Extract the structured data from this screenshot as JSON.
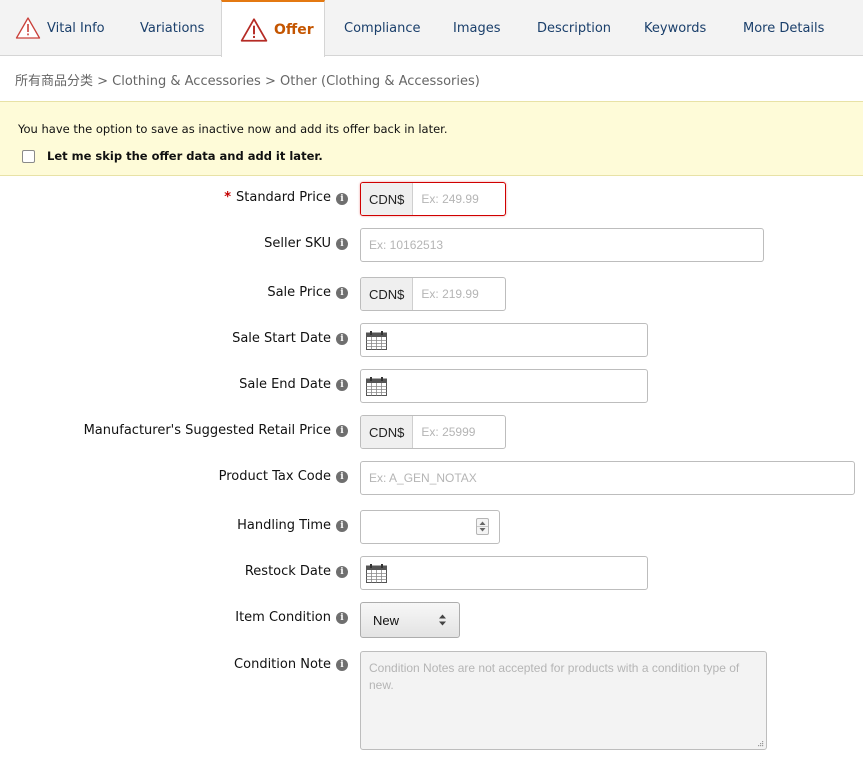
{
  "tabs": [
    {
      "label": "Vital Info",
      "warning": true,
      "active": false
    },
    {
      "label": "Variations",
      "warning": false,
      "active": false
    },
    {
      "label": "Offer",
      "warning": true,
      "active": true
    },
    {
      "label": "Compliance",
      "warning": false,
      "active": false
    },
    {
      "label": "Images",
      "warning": false,
      "active": false
    },
    {
      "label": "Description",
      "warning": false,
      "active": false
    },
    {
      "label": "Keywords",
      "warning": false,
      "active": false
    },
    {
      "label": "More Details",
      "warning": false,
      "active": false
    }
  ],
  "breadcrumb": "所有商品分类 > Clothing & Accessories > Other (Clothing & Accessories)",
  "notice": {
    "text": "You have the option to save as inactive now and add its offer back in later.",
    "skip_label": "Let me skip the offer data and add it later.",
    "skip_checked": false
  },
  "form": {
    "standard_price": {
      "label": "Standard Price",
      "required": "*",
      "currency": "CDN$",
      "placeholder": "Ex: 249.99"
    },
    "seller_sku": {
      "label": "Seller SKU",
      "placeholder": "Ex: 10162513"
    },
    "sale_price": {
      "label": "Sale Price",
      "currency": "CDN$",
      "placeholder": "Ex: 219.99"
    },
    "sale_start_date": {
      "label": "Sale Start Date"
    },
    "sale_end_date": {
      "label": "Sale End Date"
    },
    "msrp": {
      "label": "Manufacturer's Suggested Retail Price",
      "currency": "CDN$",
      "placeholder": "Ex: 25999"
    },
    "product_tax_code": {
      "label": "Product Tax Code",
      "placeholder": "Ex: A_GEN_NOTAX"
    },
    "handling_time": {
      "label": "Handling Time"
    },
    "restock_date": {
      "label": "Restock Date"
    },
    "item_condition": {
      "label": "Item Condition",
      "value": "New"
    },
    "condition_note": {
      "label": "Condition Note",
      "placeholder": "Condition Notes are not accepted for products with a condition type of new."
    }
  },
  "colors": {
    "accent": "#e47911",
    "active_tab_text": "#c45500",
    "link": "#1a3f6b",
    "error": "#d00000",
    "notice_bg": "#fefbd8"
  },
  "icons": {
    "warning": "warning-triangle-icon",
    "info": "info-icon",
    "calendar": "calendar-icon"
  }
}
